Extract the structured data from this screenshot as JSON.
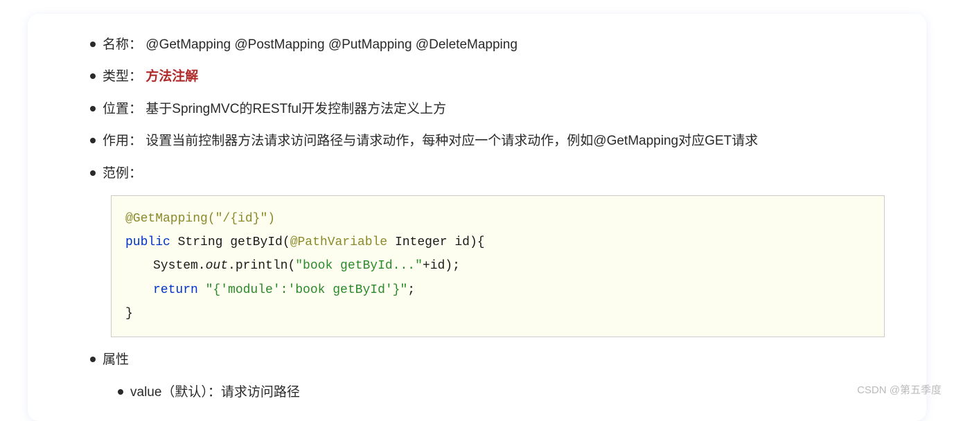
{
  "items": {
    "name": {
      "label": "名称：",
      "value": "@GetMapping   @PostMapping   @PutMapping   @DeleteMapping"
    },
    "type": {
      "label": "类型：",
      "value": "方法注解"
    },
    "location": {
      "label": "位置：",
      "value": "基于SpringMVC的RESTful开发控制器方法定义上方"
    },
    "purpose": {
      "label": "作用：",
      "value": "设置当前控制器方法请求访问路径与请求动作，每种对应一个请求动作，例如@GetMapping对应GET请求"
    },
    "example": {
      "label": "范例："
    },
    "attribute": {
      "label": "属性"
    },
    "attribute_sub": {
      "value": "value（默认）：请求访问路径"
    }
  },
  "code": {
    "getmapping": "@GetMapping",
    "getmapping_arg": "(\"/{id}\")",
    "public": "public",
    "string": "String",
    "methodname": "getById",
    "open_paren": "(",
    "pathvar": "@PathVariable",
    "integer": "Integer",
    "param": "id",
    "close_sig": "){",
    "system": "System.",
    "out": "out",
    "println_pre": ".println(",
    "println_str": "\"book getById...\"",
    "println_post": "+id);",
    "return_kw": "return",
    "return_str": "\"{'module':'book getById'}\"",
    "semicolon": ";",
    "close_brace": "}"
  },
  "watermark": "CSDN @第五季度"
}
